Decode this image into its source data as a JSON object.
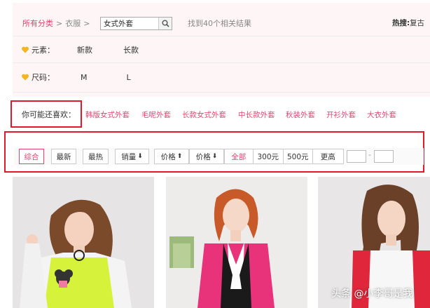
{
  "breadcrumb": {
    "all_categories": "所有分类",
    "sep1": ">",
    "category": "衣服",
    "sep2": ">"
  },
  "search": {
    "value": "女式外套"
  },
  "result_text": "找到40个相关结果",
  "hot": {
    "label": "热搜:",
    "value": "复古"
  },
  "filters": [
    {
      "label": "元素：",
      "options": [
        "新款",
        "长款"
      ]
    },
    {
      "label": "尺码：",
      "options": [
        "M",
        "L"
      ]
    }
  ],
  "may_like": {
    "label": "你可能还喜欢：",
    "items": [
      "韩版女式外套",
      "毛呢外套",
      "长款女式外套",
      "中长款外套",
      "秋装外套",
      "开衫外套",
      "大衣外套"
    ]
  },
  "sort": {
    "comprehensive": "综合",
    "newest": "最新",
    "hottest": "最热",
    "sales": "销量",
    "price_up": "价格",
    "price_down": "价格",
    "arrow_down": "⬇",
    "arrow_up": "⬆"
  },
  "price_ranges": [
    "全部",
    "300元",
    "500元",
    "更高"
  ],
  "price_range_dash": "-",
  "watermark": "头条 @小李哥是我",
  "colors": {
    "accent": "#e2446e",
    "highlight_border": "#e01a2a"
  }
}
